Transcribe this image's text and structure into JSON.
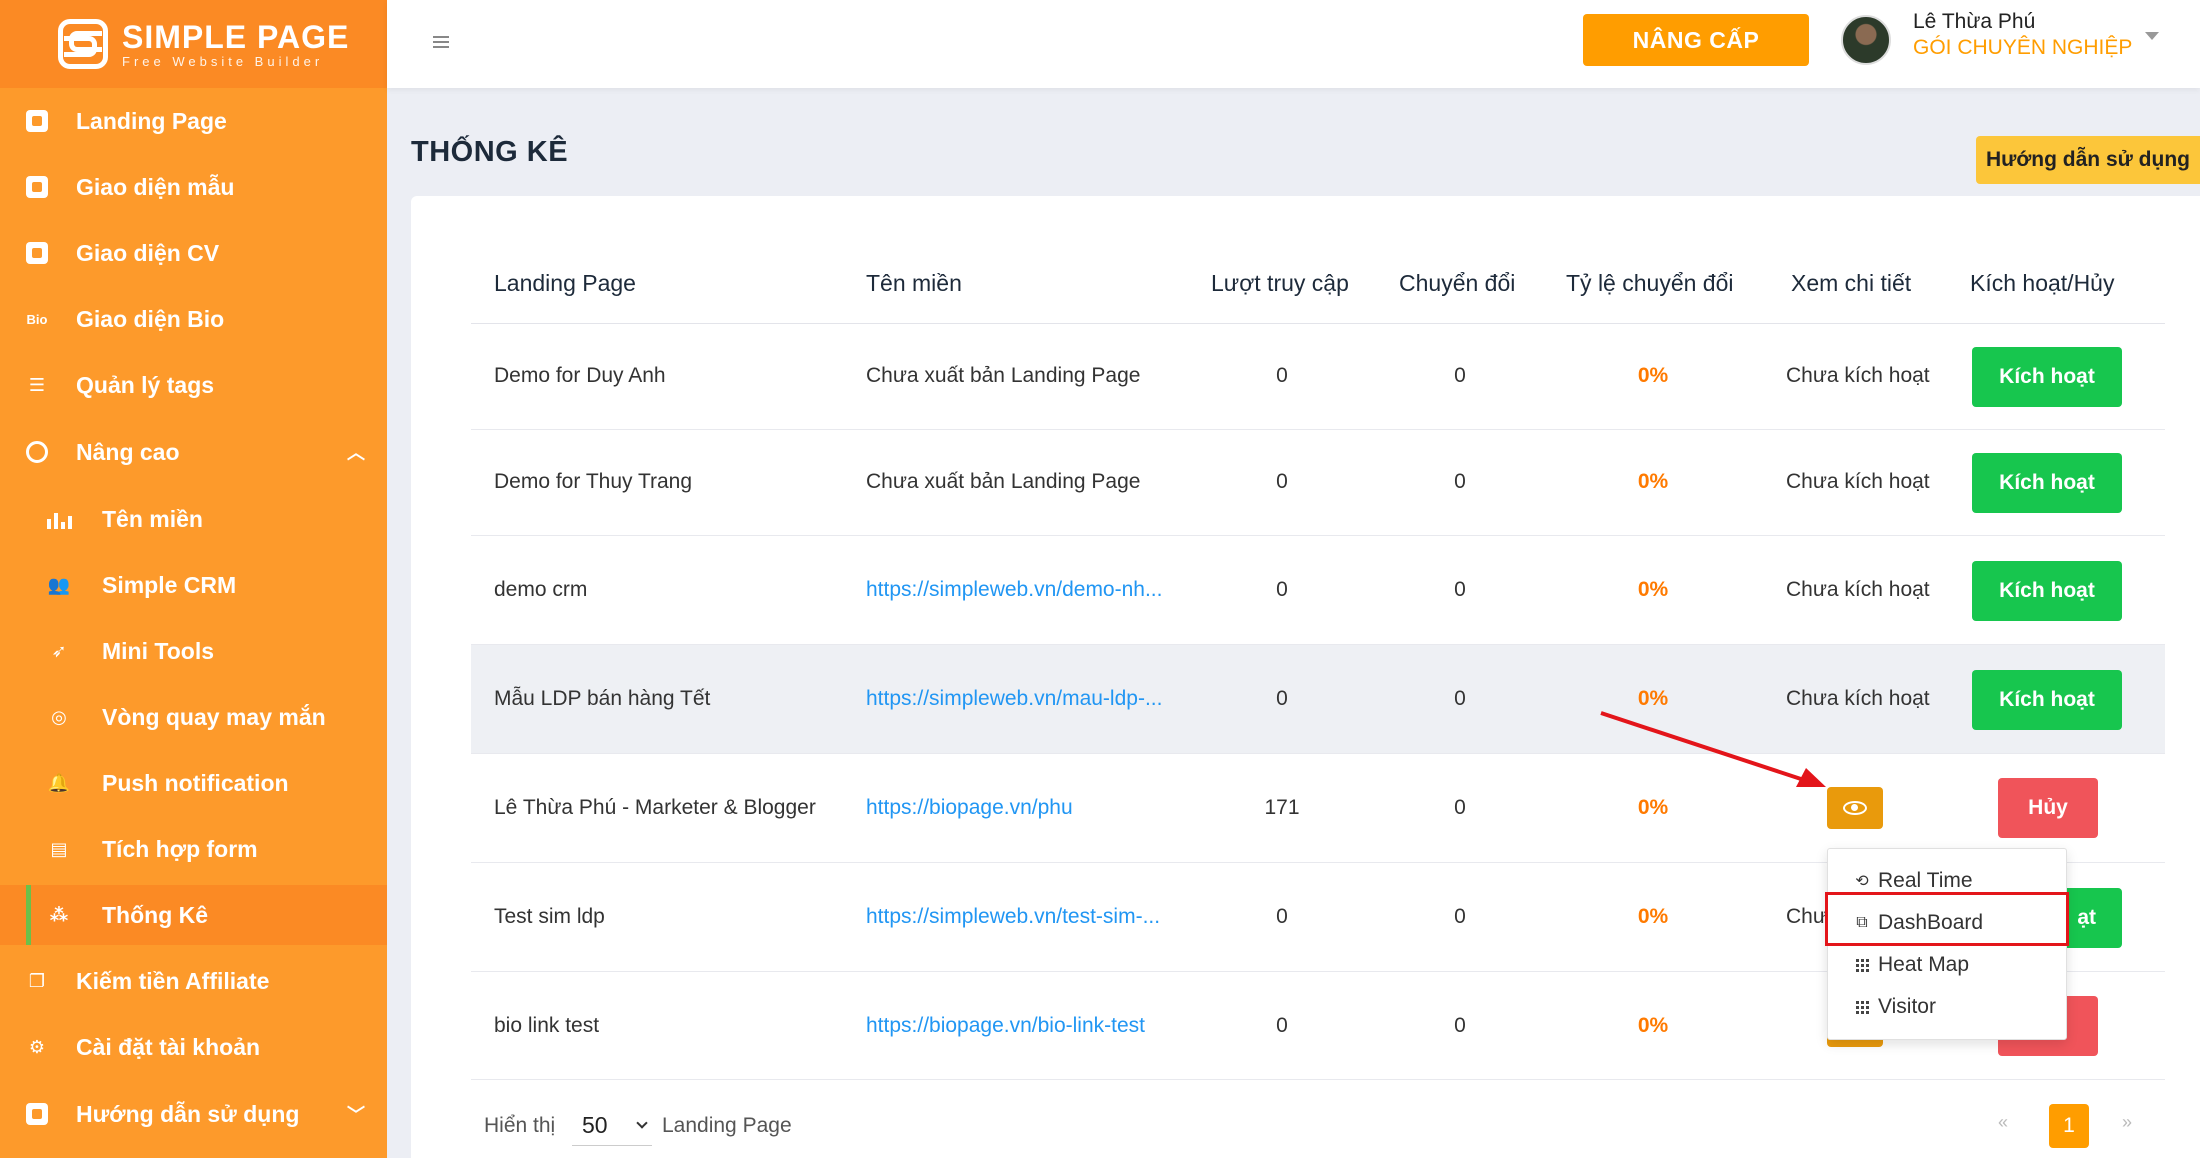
{
  "brand": {
    "name": "SIMPLE PAGE",
    "tagline": "Free Website Builder"
  },
  "sidebar": {
    "items": [
      {
        "label": "Landing Page",
        "icon": "cube-icon"
      },
      {
        "label": "Giao diện mẫu",
        "icon": "template-icon"
      },
      {
        "label": "Giao diện CV",
        "icon": "id-card-icon"
      },
      {
        "label": "Giao diện Bio",
        "icon": "bio-icon"
      },
      {
        "label": "Quản lý tags",
        "icon": "list-icon"
      },
      {
        "label": "Nâng cao",
        "icon": "star-circle-icon"
      },
      {
        "label": "Tên miền",
        "icon": "bar-chart-icon"
      },
      {
        "label": "Simple CRM",
        "icon": "users-icon"
      },
      {
        "label": "Mini Tools",
        "icon": "rocket-icon"
      },
      {
        "label": "Vòng quay may mắn",
        "icon": "wheel-icon"
      },
      {
        "label": "Push notification",
        "icon": "bell-icon"
      },
      {
        "label": "Tích hợp form",
        "icon": "form-icon"
      },
      {
        "label": "Thống Kê",
        "icon": "stats-icon"
      },
      {
        "label": "Kiếm tiền Affiliate",
        "icon": "copy-icon"
      },
      {
        "label": "Cài đặt tài khoản",
        "icon": "gear-icon"
      },
      {
        "label": "Hướng dẫn sử dụng",
        "icon": "help-icon"
      }
    ]
  },
  "header": {
    "upgrade_label": "NÂNG CẤP",
    "user_name": "Lê Thừa Phú",
    "user_plan": "GÓI CHUYÊN NGHIỆP"
  },
  "page": {
    "title": "THỐNG KÊ",
    "guide_label": "Hướng dẫn sử dụng"
  },
  "table": {
    "columns": [
      "Landing Page",
      "Tên miền",
      "Lượt truy cập",
      "Chuyển đổi",
      "Tỷ lệ chuyển đổi",
      "Xem chi tiết",
      "Kích hoạt/Hủy"
    ],
    "rows": [
      {
        "name": "Demo for Duy Anh",
        "domain": "Chưa xuất bản Landing Page",
        "visits": "0",
        "conversions": "0",
        "rate": "0%",
        "detail": "Chưa kích hoạt",
        "action": "Kích hoạt"
      },
      {
        "name": "Demo for Thuy Trang",
        "domain": "Chưa xuất bản Landing Page",
        "visits": "0",
        "conversions": "0",
        "rate": "0%",
        "detail": "Chưa kích hoạt",
        "action": "Kích hoạt"
      },
      {
        "name": "demo crm",
        "domain": "https://simpleweb.vn/demo-nh...",
        "visits": "0",
        "conversions": "0",
        "rate": "0%",
        "detail": "Chưa kích hoạt",
        "action": "Kích hoạt"
      },
      {
        "name": "Mẫu LDP bán hàng Tết",
        "domain": "https://simpleweb.vn/mau-ldp-...",
        "visits": "0",
        "conversions": "0",
        "rate": "0%",
        "detail": "Chưa kích hoạt",
        "action": "Kích hoạt"
      },
      {
        "name": "Lê Thừa Phú - Marketer & Blogger",
        "domain": "https://biopage.vn/phu",
        "visits": "171",
        "conversions": "0",
        "rate": "0%",
        "detail": "",
        "action": "Hủy"
      },
      {
        "name": "Test sim ldp",
        "domain": "https://simpleweb.vn/test-sim-...",
        "visits": "0",
        "conversions": "0",
        "rate": "0%",
        "detail": "Chư",
        "action": "ạt"
      },
      {
        "name": "bio link test",
        "domain": "https://biopage.vn/bio-link-test",
        "visits": "0",
        "conversions": "0",
        "rate": "0%",
        "detail": "",
        "action": ""
      }
    ]
  },
  "dropdown": {
    "items": [
      {
        "label": "Real Time",
        "icon": "refresh-icon"
      },
      {
        "label": "DashBoard",
        "icon": "copy-icon"
      },
      {
        "label": "Heat Map",
        "icon": "grid-icon"
      },
      {
        "label": "Visitor",
        "icon": "dots-icon"
      }
    ]
  },
  "footer": {
    "show_label": "Hiển thị",
    "page_size": "50",
    "unit_label": "Landing Page",
    "prev": "«",
    "current_page": "1",
    "next": "»"
  },
  "colors": {
    "sidebar": "#fd9a2b",
    "sidebar_dark": "#fb8a24",
    "accent": "#ff9d00",
    "success": "#17c64e",
    "danger": "#f0545a",
    "link": "#2196f3",
    "highlight": "#e3151a"
  }
}
